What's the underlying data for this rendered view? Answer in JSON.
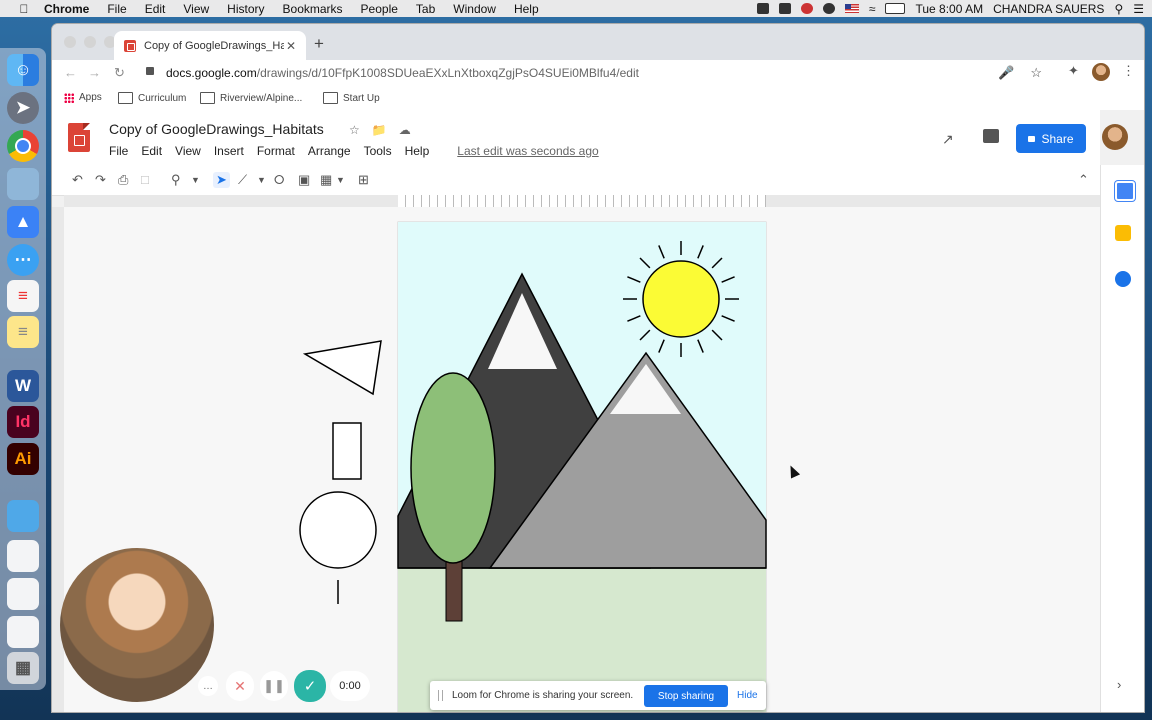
{
  "menubar": {
    "app_name": "Chrome",
    "items": [
      "File",
      "Edit",
      "View",
      "History",
      "Bookmarks",
      "People",
      "Tab",
      "Window",
      "Help"
    ],
    "clock": "Tue 8:00 AM",
    "user": "CHANDRA SAUERS"
  },
  "browser": {
    "tab_title": "Copy of GoogleDrawings_Habi",
    "url_host": "docs.google.com",
    "url_path": "/drawings/d/10FfpK1008SDUeaEXxLnXtboxqZgjPsO4SUEi0MBlfu4/edit",
    "bookmarks": [
      "Apps",
      "Curriculum",
      "Riverview/Alpine...",
      "Start Up"
    ]
  },
  "doc": {
    "title": "Copy of GoogleDrawings_Habitats",
    "menu": [
      "File",
      "Edit",
      "View",
      "Insert",
      "Format",
      "Arrange",
      "Tools",
      "Help"
    ],
    "last_edit": "Last edit was seconds ago",
    "share_label": "Share"
  },
  "recorder": {
    "timer": "0:00",
    "more": "…",
    "message": "Loom for Chrome is sharing your screen.",
    "stop_label": "Stop sharing",
    "hide_label": "Hide"
  },
  "drawing": {
    "sky_color": "#e0fbfb",
    "ground_color": "#d6e8cf",
    "sun_color": "#fbfb35",
    "tree_color": "#8dbf78",
    "trunk_color": "#5d4037",
    "back_mountain_color": "#404040",
    "front_mountain_color": "#9e9e9e"
  },
  "icons": [
    "apple-icon",
    "search-icon",
    "lock-icon",
    "star-icon",
    "puzzle-icon",
    "undo-icon",
    "redo-icon",
    "print-icon",
    "zoom-icon",
    "cursor-icon",
    "line-icon",
    "shape-icon",
    "textbox-icon",
    "image-icon",
    "comment-icon",
    "trending-icon",
    "calendar-icon",
    "keep-icon",
    "tasks-icon"
  ]
}
